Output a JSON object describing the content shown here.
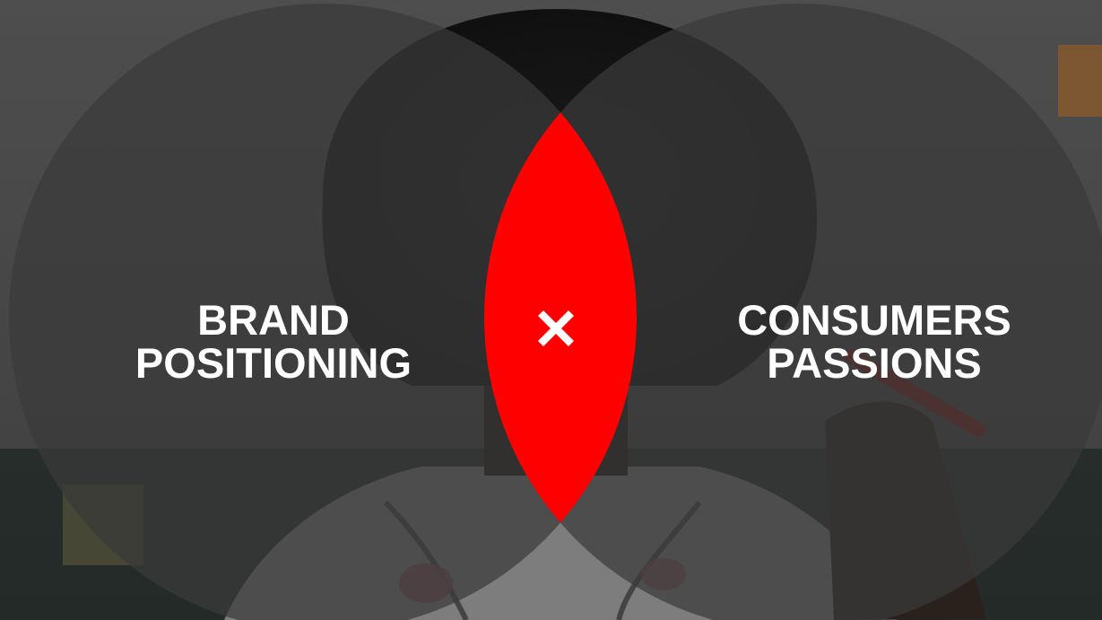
{
  "venn": {
    "left_circle": {
      "line1": "BRAND",
      "line2": "POSITIONING"
    },
    "right_circle": {
      "line1": "CONSUMERS",
      "line2": "PASSIONS"
    },
    "intersection_symbol": "times-icon"
  },
  "colors": {
    "intersection": "#ff0000",
    "circle_overlay": "#3a3a3a",
    "text": "#ffffff"
  },
  "background_image": "photo of a person with curly hair seen from behind, holding a red marker at a whiteboard"
}
